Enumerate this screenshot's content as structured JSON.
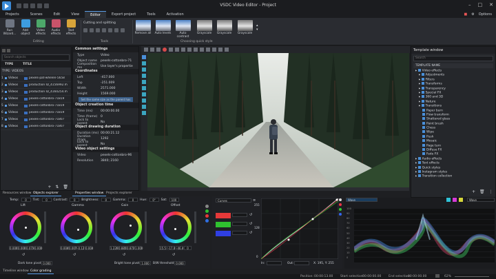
{
  "window": {
    "title": "VSDC Video Editor - Project"
  },
  "menu": {
    "items": [
      "Projects",
      "Scenes",
      "Edit",
      "View",
      "Editor",
      "Export project",
      "Tools",
      "Activation"
    ],
    "active": 4,
    "options_label": "Options"
  },
  "ribbon": {
    "buttons": [
      {
        "label": "Run Wizard..."
      },
      {
        "label": "Add object"
      },
      {
        "label": "Video effects"
      },
      {
        "label": "Audio effects"
      },
      {
        "label": "Text effects"
      }
    ],
    "editing_label": "Editing",
    "cutting_label": "Cutting and splitting",
    "tools_label": "Tools",
    "quick_styles": [
      "Remove all",
      "Auto levels",
      "Auto contrast",
      "Grayscale",
      "Grayscale",
      "Grayscale"
    ],
    "quick_style_label": "Choosing quick style"
  },
  "left_panel": {
    "search_placeholder": "Search objects",
    "col_type": "TYPE",
    "col_title": "TITLE",
    "group_label": "TYPE: VIDEOS",
    "rows": [
      {
        "n": "1",
        "type": "Videos",
        "title": "pexels-pat-whelen-5658"
      },
      {
        "n": "2",
        "type": "Videos",
        "title": "production ID_4156992.m"
      },
      {
        "n": "3",
        "type": "Videos",
        "title": "production ID_4160254.m"
      },
      {
        "n": "4",
        "type": "Videos",
        "title": "pexels-cottonbro-71819"
      },
      {
        "n": "5",
        "type": "Videos",
        "title": "pexels-cottonbro-71819"
      },
      {
        "n": "6",
        "type": "Videos",
        "title": "pexels-cottonbro-71819"
      },
      {
        "n": "7",
        "type": "Videos",
        "title": "pexels-cottonbro-71807"
      },
      {
        "n": "8",
        "type": "Videos",
        "title": "pexels-cottonbro-71807"
      }
    ],
    "tabs": [
      "Resources window",
      "Objects explorer"
    ]
  },
  "properties": {
    "common_title": "Common settings",
    "type_key": "Type",
    "type_val": "Video",
    "objname_key": "Object name",
    "objname_val": "pexels-cottonbro-71",
    "compmode_key": "Composition mo",
    "compmode_val": "Use layer's propertie",
    "coords_title": "Coordinates",
    "coords": [
      {
        "k": "Left",
        "v": "-417.000"
      },
      {
        "k": "Top",
        "v": "-251.009"
      },
      {
        "k": "Width",
        "v": "2571.000"
      },
      {
        "k": "Height",
        "v": "1569.000"
      }
    ],
    "set_same_label": "Set the same size as the parent has",
    "creation_title": "Object creation time",
    "creation": [
      {
        "k": "Time (ms)",
        "v": "00:00:00.00"
      },
      {
        "k": "Time (frame)",
        "v": "0"
      },
      {
        "k": "Lock to parent",
        "v": "No"
      }
    ],
    "duration_title": "Object drawing duration",
    "duration": [
      {
        "k": "Duration (ms)",
        "v": "00:00:21.12"
      },
      {
        "k": "Duration (fram",
        "v": "1292"
      },
      {
        "k": "Lock to parent",
        "v": "No"
      }
    ],
    "video_title": "Video object settings",
    "video": [
      {
        "k": "Video",
        "v": "pexels-cottonbro-96"
      },
      {
        "k": "Resolution",
        "v": "3840; 2160"
      }
    ],
    "tabs": [
      "Properties window",
      "Projects explorer"
    ]
  },
  "template": {
    "title": "Template window",
    "search_placeholder": "Search",
    "header": "TEMPLATE NAME",
    "items": [
      {
        "t": "Video effects",
        "lvl": 0
      },
      {
        "t": "Adjustments",
        "lvl": 1
      },
      {
        "t": "Filters",
        "lvl": 1
      },
      {
        "t": "Transforms",
        "lvl": 1
      },
      {
        "t": "Transparency",
        "lvl": 1
      },
      {
        "t": "Special FX",
        "lvl": 1
      },
      {
        "t": "360 and 3D",
        "lvl": 1
      },
      {
        "t": "Nature",
        "lvl": 1
      },
      {
        "t": "Transitions",
        "lvl": 1
      },
      {
        "t": "Paper burn",
        "lvl": 2
      },
      {
        "t": "Flow transform",
        "lvl": 2
      },
      {
        "t": "Shattered glass",
        "lvl": 2
      },
      {
        "t": "Paint brush",
        "lvl": 2
      },
      {
        "t": "Chess",
        "lvl": 2
      },
      {
        "t": "Wipe",
        "lvl": 2
      },
      {
        "t": "Push",
        "lvl": 2
      },
      {
        "t": "Mosaic",
        "lvl": 2
      },
      {
        "t": "Page turn",
        "lvl": 2
      },
      {
        "t": "Diffuse FX",
        "lvl": 2
      },
      {
        "t": "Fade FX",
        "lvl": 2
      },
      {
        "t": "Audio effects",
        "lvl": 0
      },
      {
        "t": "Text effects",
        "lvl": 0
      },
      {
        "t": "Quick styles",
        "lvl": 0
      },
      {
        "t": "Instagram styles",
        "lvl": 0
      },
      {
        "t": "Transition collection",
        "lvl": 0
      }
    ]
  },
  "color": {
    "temp_label": "Temp:",
    "temp_val": "0",
    "tint_label": "Tint:",
    "tint_val": "0",
    "contrast_label": "Contrast:",
    "contrast_val": "0",
    "brightness_label": "Brightness:",
    "brightness_val": "0",
    "gamma_label": "Gamma:",
    "gamma_val": "0",
    "hue_label": "Hue:",
    "hue_val": "0°",
    "sat_label": "Sat:",
    "sat_val": "100",
    "wheels": [
      {
        "name": "Lift",
        "vals": [
          "0.000",
          "0.000",
          "0.073",
          "0.000"
        ]
      },
      {
        "name": "Gamma",
        "vals": [
          "0.004",
          "0.007",
          "-0.121",
          "0.004"
        ]
      },
      {
        "name": "Gain",
        "vals": [
          "1.226",
          "0.885",
          "0.872",
          "1.000"
        ]
      },
      {
        "name": "Offset",
        "vals": [
          "15.5",
          "-17.0",
          "-46.4",
          "0"
        ]
      }
    ],
    "dark_tone_label": "Dark tone pivot:",
    "dark_tone_val": "0.000",
    "bright_tone_label": "Bright tone pivot:",
    "bright_tone_val": "1.000",
    "bw_label": "B/W threshold:",
    "bw_val": "0.000",
    "curves_label": "Curves",
    "in_label": "In:",
    "out_label": "Out:",
    "xy_label": "X: 195, Y: 255",
    "y_ticks": [
      "255",
      "128",
      "0"
    ],
    "scope_label": "Wave",
    "scope_mode": "Wave",
    "scope_ticks": [
      "100",
      "90",
      "80",
      "70",
      "60",
      "50",
      "40",
      "30",
      "20",
      "10",
      "0"
    ],
    "tabs": [
      "Timeline window",
      "Color grading"
    ]
  },
  "status": {
    "position_label": "Position:",
    "position_val": "00:00:13.00",
    "start_label": "Start selection:",
    "start_val": "00:00:00.00",
    "end_label": "End selection:",
    "end_val": "00:00:00.00",
    "zoom": "62%"
  }
}
